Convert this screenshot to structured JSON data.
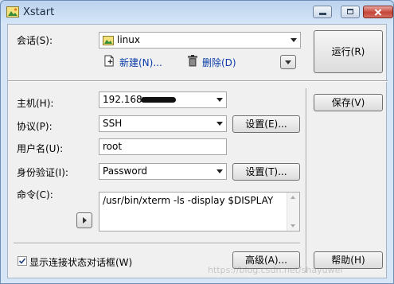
{
  "window": {
    "title": "Xstart",
    "controls": {
      "minimize": "minimize",
      "maximize": "maximize",
      "close": "close"
    }
  },
  "session": {
    "label": "会话(S):",
    "value": "linux",
    "new_label": "新建(N)...",
    "delete_label": "删除(D)",
    "run_label": "运行(R)"
  },
  "host": {
    "label": "主机(H):",
    "value": "192.168."
  },
  "protocol": {
    "label": "协议(P):",
    "value": "SSH",
    "settings_label": "设置(E)..."
  },
  "username": {
    "label": "用户名(U):",
    "value": "root"
  },
  "auth": {
    "label": "身份验证(I):",
    "value": "Password",
    "settings_label": "设置(T)..."
  },
  "command": {
    "label": "命令(C):",
    "value": "/usr/bin/xterm -ls -display $DISPLAY"
  },
  "save_label": "保存(V)",
  "show_status": {
    "label": "显示连接状态对话框(W)",
    "checked": true
  },
  "advanced_label": "高级(A)...",
  "help_label": "帮助(H)",
  "watermark": "https://blog.csdn.net/shayuwei",
  "colors": {
    "accent": "#0a3da8",
    "titlebar": "#bcd3ee",
    "close": "#c5453a"
  }
}
